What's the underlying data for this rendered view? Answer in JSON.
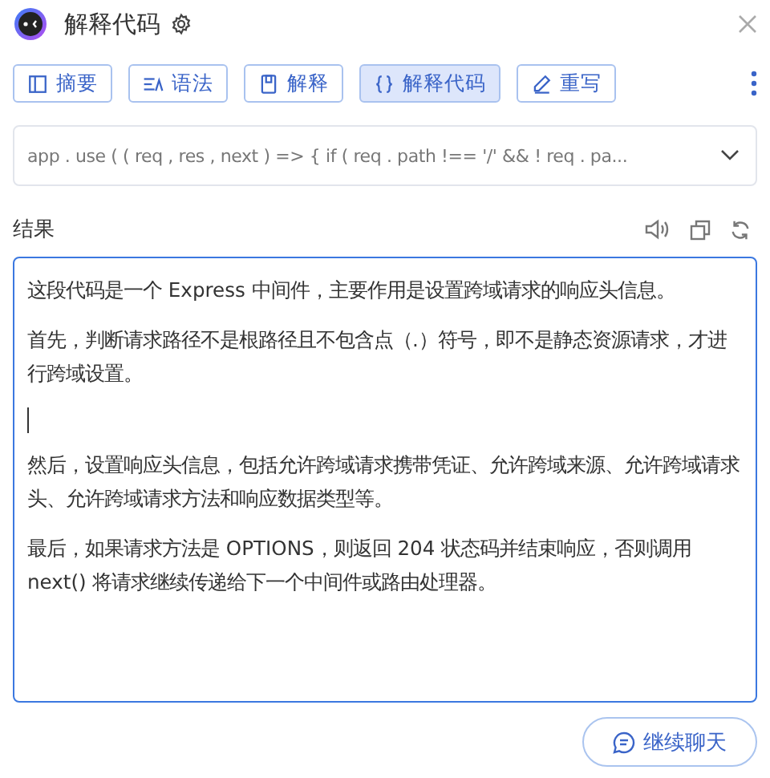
{
  "header": {
    "title": "解释代码"
  },
  "tabs": [
    {
      "label": "摘要",
      "kind": "summary",
      "selected": false
    },
    {
      "label": "语法",
      "kind": "grammar",
      "selected": false
    },
    {
      "label": "解释",
      "kind": "explain",
      "selected": false
    },
    {
      "label": "解释代码",
      "kind": "code",
      "selected": true
    },
    {
      "label": "重写",
      "kind": "rewrite",
      "selected": false
    }
  ],
  "code_field": {
    "value": "app . use ( ( req , res , next ) => { if ( req . path !== '/' && ! req . pa..."
  },
  "result": {
    "label": "结果",
    "paragraphs": [
      {
        "kind": "text",
        "text": "这段代码是一个 Express 中间件，主要作用是设置跨域请求的响应头信息。"
      },
      {
        "kind": "text",
        "text": "首先，判断请求路径不是根路径且不包含点（.）符号，即不是静态资源请求，才进行跨域设置。"
      },
      {
        "kind": "cursor"
      },
      {
        "kind": "text",
        "text": "然后，设置响应头信息，包括允许跨域请求携带凭证、允许跨域来源、允许跨域请求头、允许跨域请求方法和响应数据类型等。"
      },
      {
        "kind": "text",
        "text": "最后，如果请求方法是 OPTIONS，则返回 204 状态码并结束响应，否则调用 next() 将请求继续传递给下一个中间件或路由处理器。"
      }
    ]
  },
  "continue_button": {
    "label": "继续聊天"
  }
}
